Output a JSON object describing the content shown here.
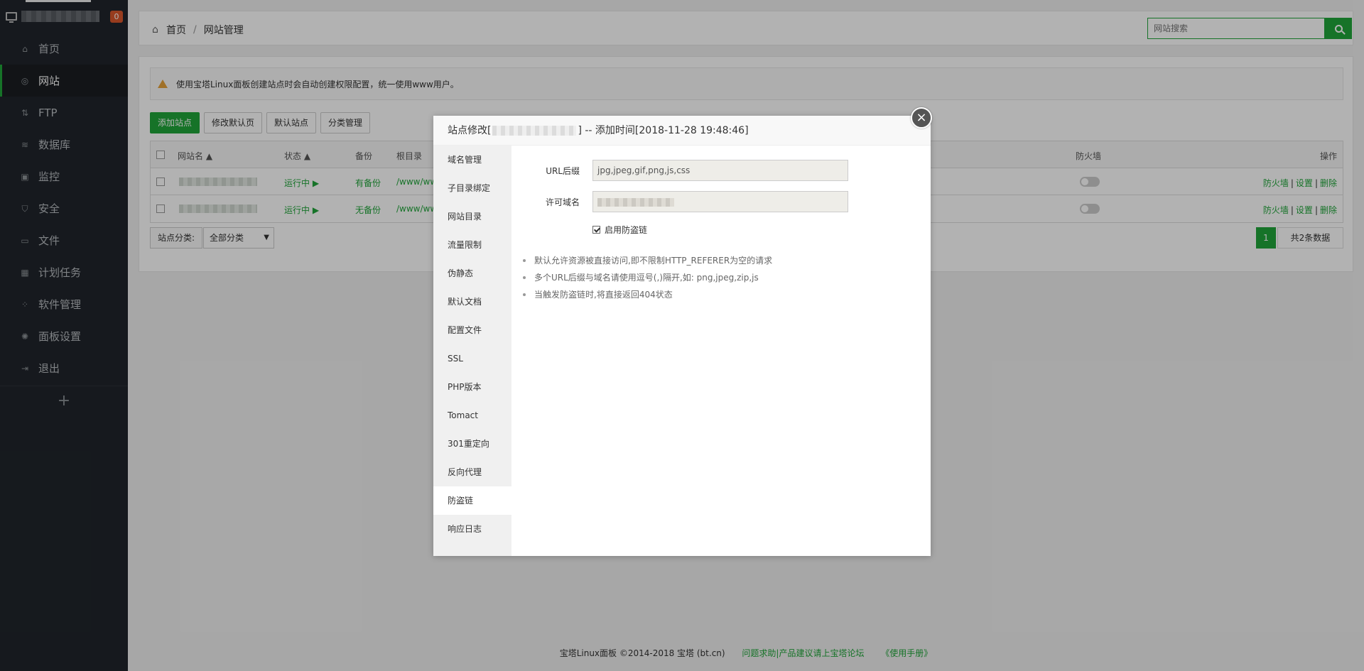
{
  "sidebar": {
    "badge": "0",
    "items": [
      {
        "label": "首页",
        "icon": "home-icon",
        "glyph": "⌂"
      },
      {
        "label": "网站",
        "icon": "globe-icon",
        "glyph": "◎"
      },
      {
        "label": "FTP",
        "icon": "ftp-icon",
        "glyph": "⇅"
      },
      {
        "label": "数据库",
        "icon": "database-icon",
        "glyph": "≋"
      },
      {
        "label": "监控",
        "icon": "monitor-icon",
        "glyph": "▣"
      },
      {
        "label": "安全",
        "icon": "shield-icon",
        "glyph": "⛉"
      },
      {
        "label": "文件",
        "icon": "folder-icon",
        "glyph": "▭"
      },
      {
        "label": "计划任务",
        "icon": "calendar-icon",
        "glyph": "▦"
      },
      {
        "label": "软件管理",
        "icon": "apps-icon",
        "glyph": "⁘"
      },
      {
        "label": "面板设置",
        "icon": "gear-icon",
        "glyph": "✺"
      },
      {
        "label": "退出",
        "icon": "logout-icon",
        "glyph": "⇥"
      }
    ],
    "add_label": "+"
  },
  "breadcrumb": {
    "home": "首页",
    "separator": "/",
    "current": "网站管理"
  },
  "search": {
    "placeholder": "网站搜索"
  },
  "alert": {
    "text": "使用宝塔Linux面板创建站点时会自动创建权限配置，统一使用www用户。"
  },
  "toolbar": {
    "add_site": "添加站点",
    "edit_default_page": "修改默认页",
    "default_site": "默认站点",
    "category_manage": "分类管理"
  },
  "table": {
    "headers": {
      "name": "网站名",
      "status": "状态",
      "backup": "备份",
      "root": "根目录",
      "firewall": "防火墙",
      "ops": "操作"
    },
    "rows": [
      {
        "status": "运行中 ▶",
        "backup": "有备份",
        "root": "/www/ww"
      },
      {
        "status": "运行中 ▶",
        "backup": "无备份",
        "root": "/www/ww"
      }
    ],
    "ops": {
      "firewall": "防火墙",
      "settings": "设置",
      "delete": "删除",
      "sep": "|"
    }
  },
  "pager": {
    "category_label": "站点分类:",
    "category_value": "全部分类",
    "current_page": "1",
    "total": "共2条数据"
  },
  "footer": {
    "copyright": "宝塔Linux面板 ©2014-2018 宝塔 (bt.cn)",
    "forum": "问题求助|产品建议请上宝塔论坛",
    "manual": "《使用手册》"
  },
  "modal": {
    "title_prefix": "站点修改[",
    "title_suffix": "] -- 添加时间[2018-11-28 19:48:46]",
    "close": "×",
    "tabs": [
      "域名管理",
      "子目录绑定",
      "网站目录",
      "流量限制",
      "伪静态",
      "默认文档",
      "配置文件",
      "SSL",
      "PHP版本",
      "Tomact",
      "301重定向",
      "反向代理",
      "防盗链",
      "响应日志"
    ],
    "active_tab": "防盗链",
    "fields": {
      "url_suffix_label": "URL后缀",
      "url_suffix_value": "jpg,jpeg,gif,png,js,css",
      "allowed_domain_label": "许可域名"
    },
    "enable_label": "启用防盗链",
    "tips": [
      "默认允许资源被直接访问,即不限制HTTP_REFERER为空的请求",
      "多个URL后缀与域名请使用逗号(,)隔开,如: png,jpeg,zip,js",
      "当触发防盗链时,将直接返回404状态"
    ]
  },
  "colors": {
    "accent": "#20a53a",
    "sidebar_bg": "#20252b",
    "badge": "#d9572b"
  }
}
